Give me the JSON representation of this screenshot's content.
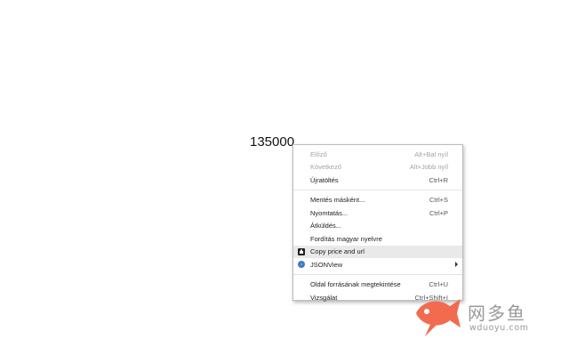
{
  "page": {
    "price_text": "135000"
  },
  "context_menu": {
    "items": [
      {
        "label": "Előző",
        "shortcut": "Alt+Bal nyíl"
      },
      {
        "label": "Következő",
        "shortcut": "Alt+Jobb nyíl"
      },
      {
        "label": "Újratöltés",
        "shortcut": "Ctrl+R"
      },
      {
        "label": "Mentés másként...",
        "shortcut": "Ctrl+S"
      },
      {
        "label": "Nyomtatás...",
        "shortcut": "Ctrl+P"
      },
      {
        "label": "Átküldés..."
      },
      {
        "label": "Fordítás magyar nyelvre"
      },
      {
        "label": "Copy price and url",
        "icon": "extension-icon"
      },
      {
        "label": "JSONView",
        "icon": "jsonview-icon"
      },
      {
        "label": "Oldal forrásának megtekintése",
        "shortcut": "Ctrl+U"
      },
      {
        "label": "Vizsgálat",
        "shortcut": "Ctrl+Shift+I"
      }
    ]
  },
  "watermark": {
    "cn_text": "网多鱼",
    "url_text": "wduoyu.com",
    "color": "#f26b4f"
  }
}
